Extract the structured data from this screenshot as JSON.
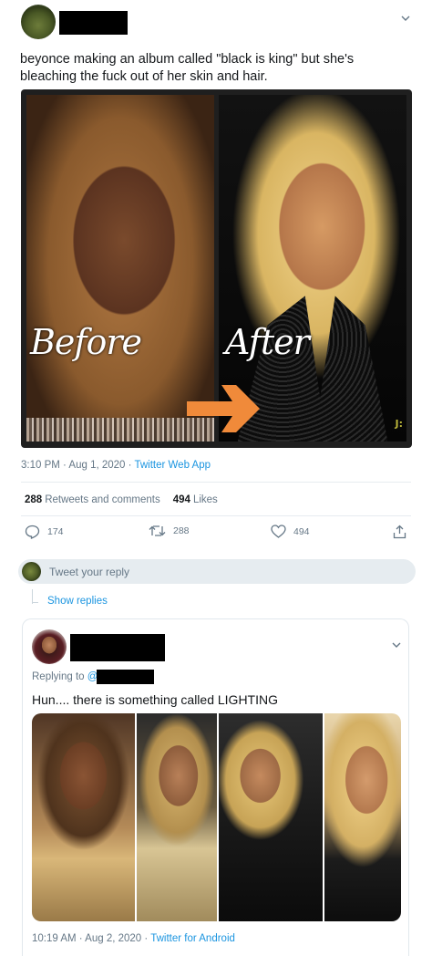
{
  "tweet": {
    "author_name": "",
    "text": "beyonce making an album called \"black is king\" but she's bleaching the fuck out of her skin and hair.",
    "media": {
      "left_label": "Before",
      "right_label": "After",
      "watermark": "J:"
    },
    "time": "3:10 PM · Aug 1, 2020",
    "separator": " · ",
    "app": "Twitter Web App",
    "stats": {
      "retweets_count": "288",
      "retweets_label": "Retweets and comments",
      "likes_count": "494",
      "likes_label": "Likes"
    },
    "actions": {
      "reply_count": "174",
      "retweet_count": "288",
      "like_count": "494"
    }
  },
  "reply_box": {
    "placeholder": "Tweet your reply"
  },
  "show_replies": "Show replies",
  "reply": {
    "replying_to_label": "Replying to ",
    "replying_to_handle": "@",
    "text": "Hun.... there is something called LIGHTING",
    "time": "10:19 AM · Aug 2, 2020",
    "separator": " · ",
    "app": "Twitter for Android"
  },
  "colors": {
    "link": "#1b95e0",
    "secondary_text": "#657786",
    "arrow": "#f08a3a"
  }
}
